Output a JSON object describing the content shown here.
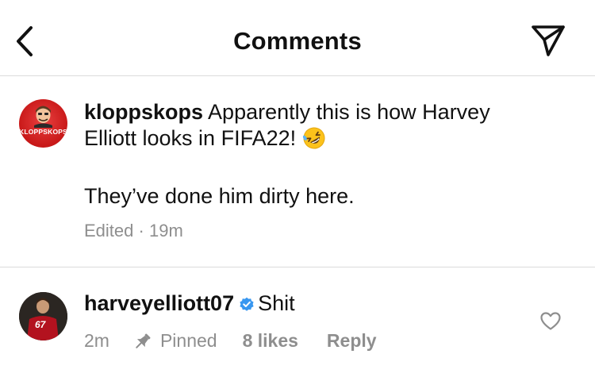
{
  "header": {
    "title": "Comments",
    "back_icon": "chevron-left-icon",
    "share_icon": "paper-plane-icon"
  },
  "caption": {
    "avatar_text": "KLOPPSKOPS",
    "username": "kloppskops",
    "text_line1": "Apparently this is how Harvey",
    "text_line2": "Elliott looks in FIFA22!",
    "emoji": "rolling-on-floor-laughing-emoji",
    "text_line3": "They’ve done him dirty here.",
    "edited_label": "Edited",
    "separator": "·",
    "time": "19m"
  },
  "reply": {
    "username": "harveyelliott07",
    "verified_icon": "verified-badge-icon",
    "text": "Shit",
    "jersey_number": "67",
    "time": "2m",
    "pinned_label": "Pinned",
    "likes_label": "8 likes",
    "reply_label": "Reply",
    "like_icon": "heart-outline-icon"
  },
  "colors": {
    "text": "#111111",
    "secondary_text": "#8e8e8e",
    "divider": "#dbdbdb",
    "verified_blue": "#3897f0",
    "avatar_red": "#d11f1f"
  }
}
